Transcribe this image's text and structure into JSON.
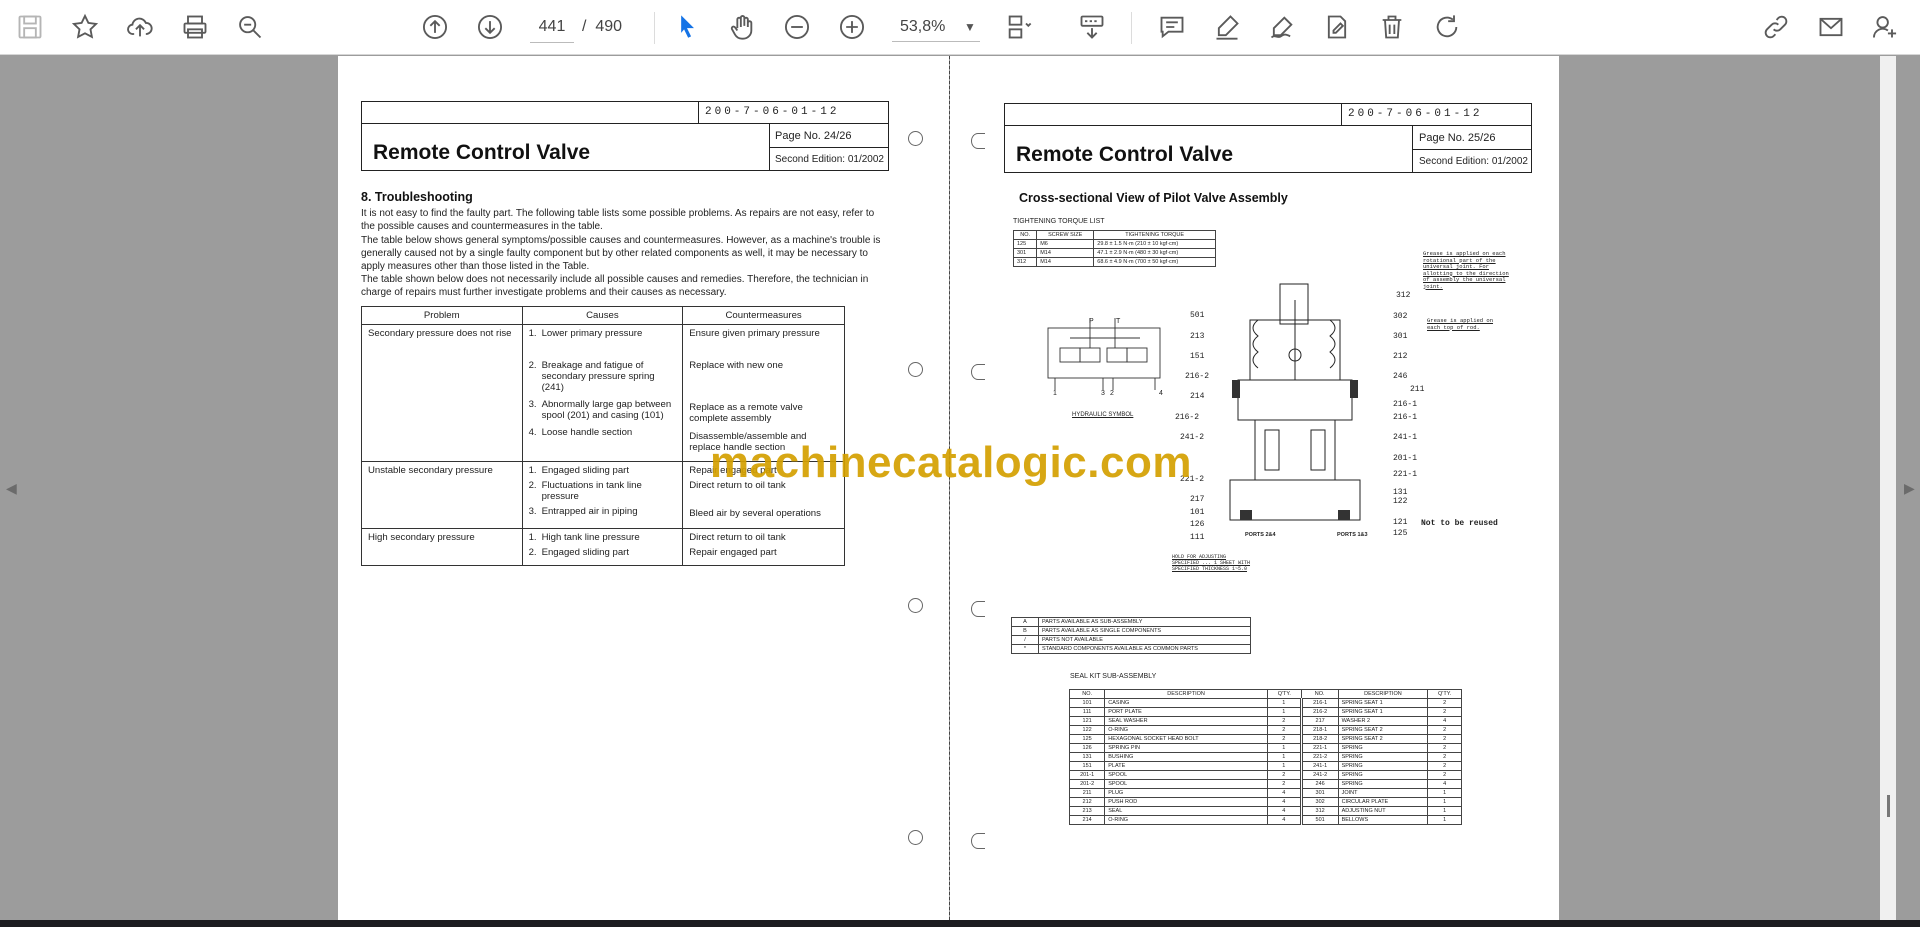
{
  "toolbar": {
    "icons": [
      "save-icon",
      "bookmark-star-icon",
      "upload-cloud-icon",
      "print-icon",
      "zoom-search-icon",
      "page-up-icon",
      "page-down-icon",
      "select-cursor-icon",
      "hand-tool-icon",
      "zoom-out-icon",
      "zoom-in-icon",
      "fit-page-icon",
      "read-mode-icon",
      "comment-icon",
      "highlight-pen-icon",
      "draw-signature-icon",
      "fill-sign-icon",
      "delete-icon",
      "rotate-icon",
      "share-link-icon",
      "email-icon",
      "account-add-icon"
    ],
    "current_page": "441",
    "page_separator": "/",
    "total_pages": "490",
    "zoom": "53,8%",
    "accent_color": "#1473e6"
  },
  "watermark": "machinecatalogic.com",
  "left_page": {
    "doc_number": "200-7-06-01-12",
    "title": "Remote Control Valve",
    "page_no": "Page No. 24/26",
    "edition": "Second Edition: 01/2002",
    "section_title": "8. Troubleshooting",
    "paragraphs": [
      "It is not easy to find the faulty part. The following table lists some possible problems. As repairs are not easy, refer to the possible causes and countermeasures in the table.",
      "The table below shows general symptoms/possible causes and countermeasures. However, as a machine's trouble is generally caused not by a single faulty component but by other related components as well, it may be necessary to apply measures other than those listed in the Table.",
      "The table shown below does not necessarily include all possible causes and remedies. Therefore, the technician in charge of repairs must further investigate problems and their causes as necessary."
    ],
    "table_headers": [
      "Problem",
      "Causes",
      "Countermeasures"
    ],
    "rows": [
      {
        "problem": "Secondary pressure does not rise",
        "causes": [
          {
            "n": "1.",
            "t": "Lower primary pressure"
          },
          {
            "n": "2.",
            "t": "Breakage and fatigue of secondary pressure spring (241)"
          },
          {
            "n": "3.",
            "t": "Abnormally large gap between spool (201) and casing (101)"
          },
          {
            "n": "4.",
            "t": "Loose handle section"
          }
        ],
        "measures": [
          "Ensure given primary pressure",
          "Replace with new one",
          "Replace as a remote valve complete assembly",
          "Disassemble/assemble and replace handle section"
        ]
      },
      {
        "problem": "Unstable secondary pressure",
        "causes": [
          {
            "n": "1.",
            "t": "Engaged sliding part"
          },
          {
            "n": "2.",
            "t": "Fluctuations in tank line pressure"
          },
          {
            "n": "3.",
            "t": "Entrapped air in piping"
          }
        ],
        "measures": [
          "Repair engaged part",
          "Direct return to oil tank",
          "Bleed air by several operations"
        ]
      },
      {
        "problem": "High secondary pressure",
        "causes": [
          {
            "n": "1.",
            "t": "High tank line pressure"
          },
          {
            "n": "2.",
            "t": "Engaged sliding part"
          }
        ],
        "measures": [
          "Direct return to oil tank",
          "Repair engaged part"
        ]
      }
    ]
  },
  "right_page": {
    "doc_number": "200-7-06-01-12",
    "title": "Remote Control Valve",
    "page_no": "Page No. 25/26",
    "edition": "Second Edition: 01/2002",
    "section_title": "Cross-sectional View of Pilot Valve Assembly",
    "torque_caption": "TIGHTENING TORQUE LIST",
    "torque_headers": [
      "NO.",
      "SCREW SIZE",
      "TIGHTENING TORQUE"
    ],
    "torque_rows": [
      [
        "125",
        "M6",
        "29.8 ± 1.5 N·m (210 ± 10 kgf·cm)"
      ],
      [
        "301",
        "M14",
        "47.1 ± 2.9 N·m (480 ± 30 kgf·cm)"
      ],
      [
        "312",
        "M14",
        "68.6 ± 4.9 N·m (700 ± 50 kgf·cm)"
      ]
    ],
    "symbol_caption": "HYDRAULIC SYMBOL",
    "symbol_ports": [
      "P",
      "T",
      "1",
      "3",
      "2",
      "4"
    ],
    "port_labels": [
      "PORTS 2&4",
      "PORTS 1&3"
    ],
    "callouts_left": [
      "501",
      "213",
      "151",
      "216-2",
      "214",
      "216-2",
      "241-2",
      "221-2",
      "217",
      "101",
      "126",
      "111"
    ],
    "callouts_right": [
      "312",
      "302",
      "301",
      "212",
      "246",
      "211",
      "216-1",
      "216-1",
      "241-1",
      "201-1",
      "221-1",
      "131",
      "122",
      "121",
      "125"
    ],
    "grease_note_1": "Grease is applied on each rotational part of the universal joint. For allotting to the direction of assembly the universal joint.",
    "grease_note_2": "Grease is applied on each top of rod.",
    "not_reused": "Not to be reused",
    "bottom_note": "HOLD FOR ADJUSTING SPECIFIED ... 1 SHEET WITH SPECIFIED THICKNESS 1~5.0",
    "legend": [
      [
        "A",
        "PARTS AVAILABLE AS SUB-ASSEMBLY"
      ],
      [
        "B",
        "PARTS AVAILABLE AS SINGLE COMPONENTS"
      ],
      [
        "/",
        "PARTS NOT AVAILABLE"
      ],
      [
        "*",
        "STANDARD COMPONENTS AVAILABLE AS COMMON PARTS"
      ]
    ],
    "seal_caption": "SEAL KIT SUB-ASSEMBLY",
    "seal_headers": [
      "NO.",
      "DESCRIPTION",
      "Q'TY.",
      "NO.",
      "DESCRIPTION",
      "Q'TY."
    ],
    "seal_rows": [
      [
        "101",
        "CASING",
        "1",
        "216-1",
        "SPRING SEAT 1",
        "2"
      ],
      [
        "111",
        "PORT PLATE",
        "1",
        "216-2",
        "SPRING SEAT 1",
        "2"
      ],
      [
        "121",
        "SEAL WASHER",
        "2",
        "217",
        "WASHER 2",
        "4"
      ],
      [
        "122",
        "O-RING",
        "2",
        "218-1",
        "SPRING SEAT 2",
        "2"
      ],
      [
        "125",
        "HEXAGONAL SOCKET HEAD BOLT",
        "2",
        "218-2",
        "SPRING SEAT 2",
        "2"
      ],
      [
        "126",
        "SPRING PIN",
        "1",
        "221-1",
        "SPRING",
        "2"
      ],
      [
        "131",
        "BUSHING",
        "1",
        "221-2",
        "SPRING",
        "2"
      ],
      [
        "151",
        "PLATE",
        "1",
        "241-1",
        "SPRING",
        "2"
      ],
      [
        "201-1",
        "SPOOL",
        "2",
        "241-2",
        "SPRING",
        "2"
      ],
      [
        "201-2",
        "SPOOL",
        "2",
        "246",
        "SPRING",
        "4"
      ],
      [
        "211",
        "PLUG",
        "4",
        "301",
        "JOINT",
        "1"
      ],
      [
        "212",
        "PUSH ROD",
        "4",
        "302",
        "CIRCULAR PLATE",
        "1"
      ],
      [
        "213",
        "SEAL",
        "4",
        "312",
        "ADJUSTING NUT",
        "1"
      ],
      [
        "214",
        "O-RING",
        "4",
        "501",
        "BELLOWS",
        "1"
      ]
    ]
  }
}
